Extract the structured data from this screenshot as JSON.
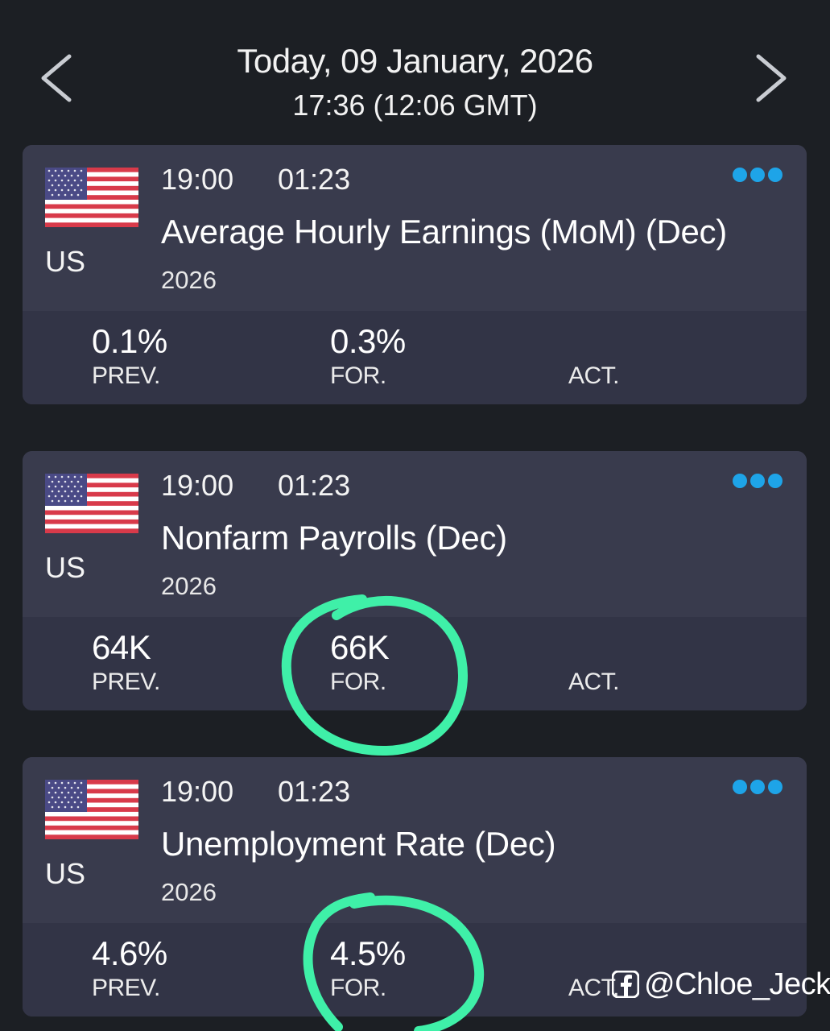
{
  "header": {
    "title": "Today, 09 January, 2026",
    "subtitle": "17:36 (12:06 GMT)",
    "prev_icon": "chevron-left-icon",
    "next_icon": "chevron-right-icon"
  },
  "events": [
    {
      "country": "US",
      "time": "19:00",
      "countdown": "01:23",
      "title": "Average Hourly Earnings (MoM)  (Dec)",
      "year": "2026",
      "prev_value": "0.1%",
      "prev_label": "PREV.",
      "forecast_value": "0.3%",
      "forecast_label": "FOR.",
      "actual_value": "",
      "actual_label": "ACT."
    },
    {
      "country": "US",
      "time": "19:00",
      "countdown": "01:23",
      "title": "Nonfarm Payrolls  (Dec)",
      "year": "2026",
      "prev_value": "64K",
      "prev_label": "PREV.",
      "forecast_value": "66K",
      "forecast_label": "FOR.",
      "actual_value": "",
      "actual_label": "ACT."
    },
    {
      "country": "US",
      "time": "19:00",
      "countdown": "01:23",
      "title": "Unemployment Rate  (Dec)",
      "year": "2026",
      "prev_value": "4.6%",
      "prev_label": "PREV.",
      "forecast_value": "4.5%",
      "forecast_label": "FOR.",
      "actual_value": "",
      "actual_label": "ACT."
    }
  ],
  "watermark": {
    "text": "@Chloe_Jeck",
    "icon": "facebook-icon"
  },
  "colors": {
    "background": "#1c1f24",
    "card": "#393b4d",
    "card_stats": "#323446",
    "accent_dots": "#1ea4e8",
    "annotation_circle": "#3ff0a8"
  }
}
